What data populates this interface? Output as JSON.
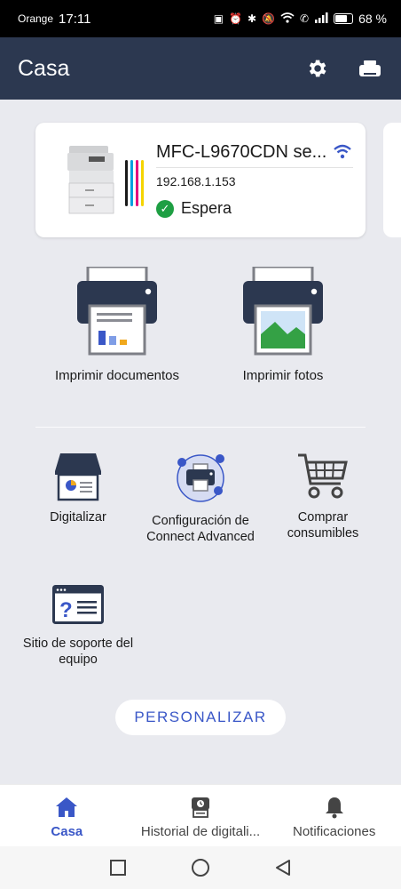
{
  "status_bar": {
    "carrier": "Orange",
    "time": "17:11",
    "battery": "68 %"
  },
  "app_bar": {
    "title": "Casa",
    "actions": [
      "gear-icon",
      "printer-icon"
    ]
  },
  "device": {
    "name": "MFC-L9670CDN se...",
    "ip": "192.168.1.153",
    "status": "Espera",
    "ink_colors": [
      "#1a1a1a",
      "#00a0e0",
      "#e5007e",
      "#f5d400"
    ],
    "status_color": "#1e9f43"
  },
  "primary_actions": [
    {
      "label": "Imprimir documentos",
      "icon": "print-documents-icon"
    },
    {
      "label": "Imprimir fotos",
      "icon": "print-photos-icon"
    }
  ],
  "secondary_actions": [
    {
      "label": "Digitalizar",
      "icon": "scan-icon"
    },
    {
      "label": "Configuración de Connect Advanced",
      "icon": "connect-advanced-icon"
    },
    {
      "label": "Comprar consumibles",
      "icon": "shopping-cart-icon"
    },
    {
      "label": "Sitio de soporte del equipo",
      "icon": "support-site-icon"
    }
  ],
  "personalize_label": "PERSONALIZAR",
  "bottom_nav": [
    {
      "label": "Casa",
      "icon": "home-icon",
      "active": true
    },
    {
      "label": "Historial de digitali...",
      "icon": "scan-history-icon",
      "active": false
    },
    {
      "label": "Notificaciones",
      "icon": "bell-icon",
      "active": false
    }
  ],
  "colors": {
    "app_bar": "#2c3850",
    "accent": "#3a57c7",
    "background": "#e9eaef"
  }
}
